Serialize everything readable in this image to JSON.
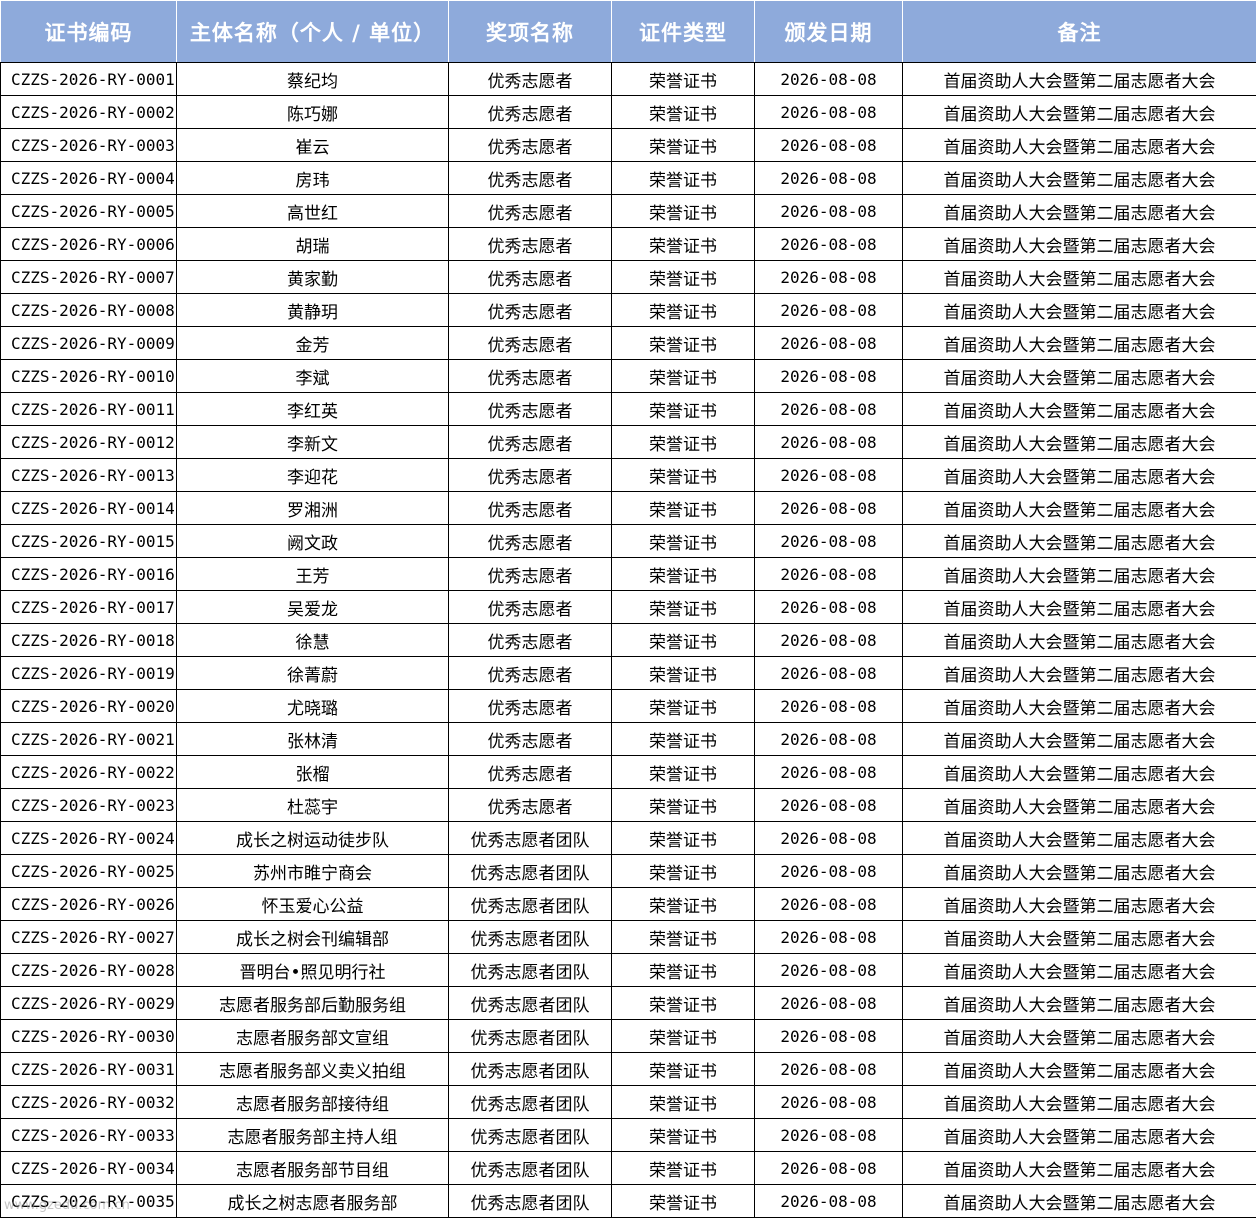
{
  "table": {
    "headers": [
      "证书编码",
      "主体名称（个人 / 单位）",
      "奖项名称",
      "证件类型",
      "颁发日期",
      "备注"
    ],
    "rows": [
      [
        "CZZS-2026-RY-0001",
        "蔡纪均",
        "优秀志愿者",
        "荣誉证书",
        "2026-08-08",
        "首届资助人大会暨第二届志愿者大会"
      ],
      [
        "CZZS-2026-RY-0002",
        "陈巧娜",
        "优秀志愿者",
        "荣誉证书",
        "2026-08-08",
        "首届资助人大会暨第二届志愿者大会"
      ],
      [
        "CZZS-2026-RY-0003",
        "崔云",
        "优秀志愿者",
        "荣誉证书",
        "2026-08-08",
        "首届资助人大会暨第二届志愿者大会"
      ],
      [
        "CZZS-2026-RY-0004",
        "房玮",
        "优秀志愿者",
        "荣誉证书",
        "2026-08-08",
        "首届资助人大会暨第二届志愿者大会"
      ],
      [
        "CZZS-2026-RY-0005",
        "高世红",
        "优秀志愿者",
        "荣誉证书",
        "2026-08-08",
        "首届资助人大会暨第二届志愿者大会"
      ],
      [
        "CZZS-2026-RY-0006",
        "胡瑞",
        "优秀志愿者",
        "荣誉证书",
        "2026-08-08",
        "首届资助人大会暨第二届志愿者大会"
      ],
      [
        "CZZS-2026-RY-0007",
        "黄家勤",
        "优秀志愿者",
        "荣誉证书",
        "2026-08-08",
        "首届资助人大会暨第二届志愿者大会"
      ],
      [
        "CZZS-2026-RY-0008",
        "黄静玥",
        "优秀志愿者",
        "荣誉证书",
        "2026-08-08",
        "首届资助人大会暨第二届志愿者大会"
      ],
      [
        "CZZS-2026-RY-0009",
        "金芳",
        "优秀志愿者",
        "荣誉证书",
        "2026-08-08",
        "首届资助人大会暨第二届志愿者大会"
      ],
      [
        "CZZS-2026-RY-0010",
        "李斌",
        "优秀志愿者",
        "荣誉证书",
        "2026-08-08",
        "首届资助人大会暨第二届志愿者大会"
      ],
      [
        "CZZS-2026-RY-0011",
        "李红英",
        "优秀志愿者",
        "荣誉证书",
        "2026-08-08",
        "首届资助人大会暨第二届志愿者大会"
      ],
      [
        "CZZS-2026-RY-0012",
        "李新文",
        "优秀志愿者",
        "荣誉证书",
        "2026-08-08",
        "首届资助人大会暨第二届志愿者大会"
      ],
      [
        "CZZS-2026-RY-0013",
        "李迎花",
        "优秀志愿者",
        "荣誉证书",
        "2026-08-08",
        "首届资助人大会暨第二届志愿者大会"
      ],
      [
        "CZZS-2026-RY-0014",
        "罗湘洲",
        "优秀志愿者",
        "荣誉证书",
        "2026-08-08",
        "首届资助人大会暨第二届志愿者大会"
      ],
      [
        "CZZS-2026-RY-0015",
        "阙文政",
        "优秀志愿者",
        "荣誉证书",
        "2026-08-08",
        "首届资助人大会暨第二届志愿者大会"
      ],
      [
        "CZZS-2026-RY-0016",
        "王芳",
        "优秀志愿者",
        "荣誉证书",
        "2026-08-08",
        "首届资助人大会暨第二届志愿者大会"
      ],
      [
        "CZZS-2026-RY-0017",
        "吴爱龙",
        "优秀志愿者",
        "荣誉证书",
        "2026-08-08",
        "首届资助人大会暨第二届志愿者大会"
      ],
      [
        "CZZS-2026-RY-0018",
        "徐慧",
        "优秀志愿者",
        "荣誉证书",
        "2026-08-08",
        "首届资助人大会暨第二届志愿者大会"
      ],
      [
        "CZZS-2026-RY-0019",
        "徐菁蔚",
        "优秀志愿者",
        "荣誉证书",
        "2026-08-08",
        "首届资助人大会暨第二届志愿者大会"
      ],
      [
        "CZZS-2026-RY-0020",
        "尤晓璐",
        "优秀志愿者",
        "荣誉证书",
        "2026-08-08",
        "首届资助人大会暨第二届志愿者大会"
      ],
      [
        "CZZS-2026-RY-0021",
        "张林清",
        "优秀志愿者",
        "荣誉证书",
        "2026-08-08",
        "首届资助人大会暨第二届志愿者大会"
      ],
      [
        "CZZS-2026-RY-0022",
        "张榴",
        "优秀志愿者",
        "荣誉证书",
        "2026-08-08",
        "首届资助人大会暨第二届志愿者大会"
      ],
      [
        "CZZS-2026-RY-0023",
        "杜蕊宇",
        "优秀志愿者",
        "荣誉证书",
        "2026-08-08",
        "首届资助人大会暨第二届志愿者大会"
      ],
      [
        "CZZS-2026-RY-0024",
        "成长之树运动徒步队",
        "优秀志愿者团队",
        "荣誉证书",
        "2026-08-08",
        "首届资助人大会暨第二届志愿者大会"
      ],
      [
        "CZZS-2026-RY-0025",
        "苏州市睢宁商会",
        "优秀志愿者团队",
        "荣誉证书",
        "2026-08-08",
        "首届资助人大会暨第二届志愿者大会"
      ],
      [
        "CZZS-2026-RY-0026",
        "怀玉爱心公益",
        "优秀志愿者团队",
        "荣誉证书",
        "2026-08-08",
        "首届资助人大会暨第二届志愿者大会"
      ],
      [
        "CZZS-2026-RY-0027",
        "成长之树会刊编辑部",
        "优秀志愿者团队",
        "荣誉证书",
        "2026-08-08",
        "首届资助人大会暨第二届志愿者大会"
      ],
      [
        "CZZS-2026-RY-0028",
        "晋明台•照见明行社",
        "优秀志愿者团队",
        "荣誉证书",
        "2026-08-08",
        "首届资助人大会暨第二届志愿者大会"
      ],
      [
        "CZZS-2026-RY-0029",
        "志愿者服务部后勤服务组",
        "优秀志愿者团队",
        "荣誉证书",
        "2026-08-08",
        "首届资助人大会暨第二届志愿者大会"
      ],
      [
        "CZZS-2026-RY-0030",
        "志愿者服务部文宣组",
        "优秀志愿者团队",
        "荣誉证书",
        "2026-08-08",
        "首届资助人大会暨第二届志愿者大会"
      ],
      [
        "CZZS-2026-RY-0031",
        "志愿者服务部义卖义拍组",
        "优秀志愿者团队",
        "荣誉证书",
        "2026-08-08",
        "首届资助人大会暨第二届志愿者大会"
      ],
      [
        "CZZS-2026-RY-0032",
        "志愿者服务部接待组",
        "优秀志愿者团队",
        "荣誉证书",
        "2026-08-08",
        "首届资助人大会暨第二届志愿者大会"
      ],
      [
        "CZZS-2026-RY-0033",
        "志愿者服务部主持人组",
        "优秀志愿者团队",
        "荣誉证书",
        "2026-08-08",
        "首届资助人大会暨第二届志愿者大会"
      ],
      [
        "CZZS-2026-RY-0034",
        "志愿者服务部节目组",
        "优秀志愿者团队",
        "荣誉证书",
        "2026-08-08",
        "首届资助人大会暨第二届志愿者大会"
      ],
      [
        "CZZS-2026-RY-0035",
        "成长之树志愿者服务部",
        "优秀志愿者团队",
        "荣誉证书",
        "2026-08-08",
        "首届资助人大会暨第二届志愿者大会"
      ]
    ]
  },
  "watermark": "www.gzedu.com.cn",
  "colors": {
    "header_background": "#8eaadb",
    "header_text": "#ffffff",
    "border": "#000000"
  }
}
